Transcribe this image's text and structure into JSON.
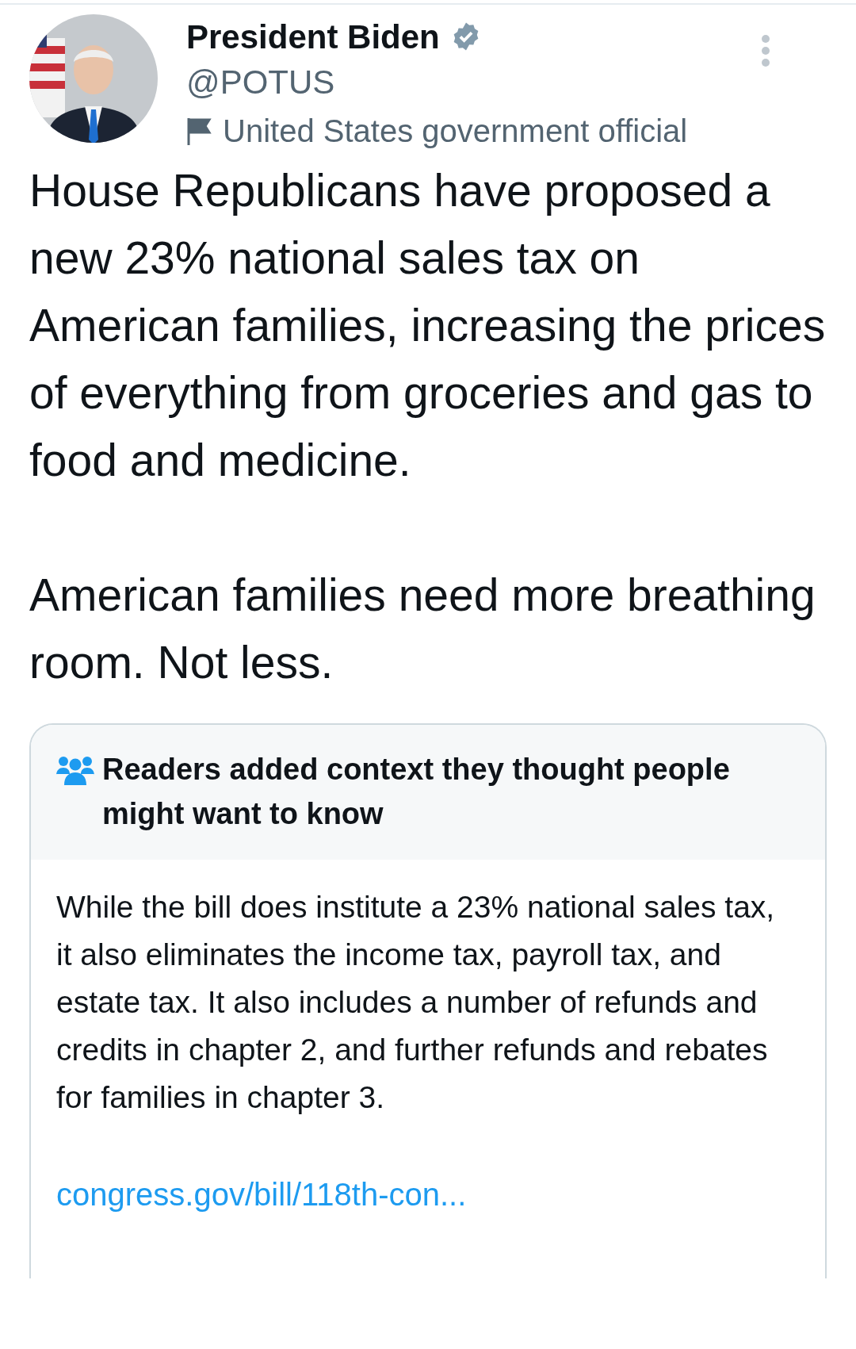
{
  "author": {
    "name": "President Biden",
    "verified": true,
    "handle": "@POTUS",
    "label": "United States government official"
  },
  "tweet": {
    "paragraphs": [
      "House Republicans have proposed a new 23% national sales tax on American families, increasing the prices of everything from groceries and gas to food and medicine.",
      "American families need more breathing room. Not less."
    ]
  },
  "community_note": {
    "title": "Readers added context they thought people might want to know",
    "body": "While the bill does institute a 23% national sales tax, it also eliminates the income tax, payroll tax, and estate tax. It also includes a number of refunds and credits in chapter 2, and further refunds and rebates for families in chapter 3.",
    "link": "congress.gov/bill/118th-con..."
  }
}
